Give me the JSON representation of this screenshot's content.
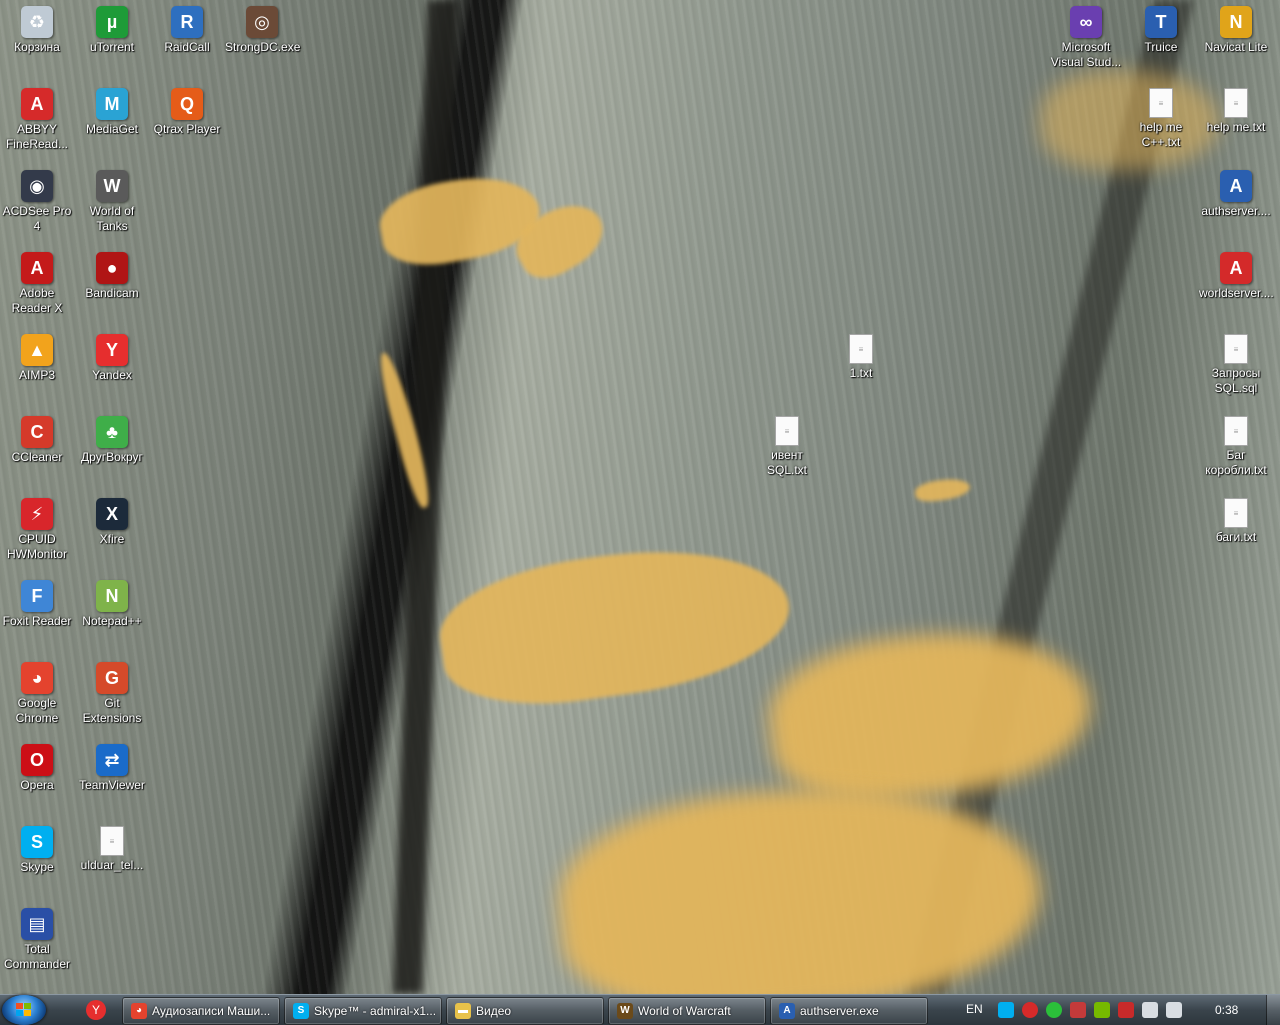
{
  "desktop_icons": [
    {
      "label": "Корзина",
      "icon": "recycle-bin-icon",
      "color": "#bfcad4"
    },
    {
      "label": "uTorrent",
      "icon": "utorrent-icon",
      "color": "#1e9b38"
    },
    {
      "label": "RaidCall",
      "icon": "raidcall-icon",
      "color": "#2e6fbf"
    },
    {
      "label": "StrongDC.exe",
      "icon": "strongdc-icon",
      "color": "#6b4a37"
    },
    {
      "label": "ABBYY FineRead...",
      "icon": "abbyy-icon",
      "color": "#d62a2a"
    },
    {
      "label": "MediaGet",
      "icon": "mediaget-icon",
      "color": "#2aa3d4"
    },
    {
      "label": "Qtrax Player",
      "icon": "qtrax-icon",
      "color": "#e55c19"
    },
    {
      "label": "ACDSee Pro 4",
      "icon": "acdsee-icon",
      "color": "#333a4a"
    },
    {
      "label": "World of Tanks",
      "icon": "world-of-tanks-icon",
      "color": "#5a5a5a"
    },
    {
      "label": "Adobe Reader X",
      "icon": "adobe-reader-icon",
      "color": "#c41a1a"
    },
    {
      "label": "Bandicam",
      "icon": "bandicam-icon",
      "color": "#b01515"
    },
    {
      "label": "AIMP3",
      "icon": "aimp-icon",
      "color": "#f2a31c"
    },
    {
      "label": "Yandex",
      "icon": "yandex-icon",
      "color": "#e62e2e"
    },
    {
      "label": "CCleaner",
      "icon": "ccleaner-icon",
      "color": "#d53a2a"
    },
    {
      "label": "ДругВокруг",
      "icon": "drugvokrug-icon",
      "color": "#3fae49"
    },
    {
      "label": "CPUID HWMonitor",
      "icon": "hwmonitor-icon",
      "color": "#d8262b"
    },
    {
      "label": "Xfire",
      "icon": "xfire-icon",
      "color": "#1c2a3a"
    },
    {
      "label": "Foxit Reader",
      "icon": "foxit-icon",
      "color": "#3f86d6"
    },
    {
      "label": "Notepad++",
      "icon": "notepadpp-icon",
      "color": "#7fb34a"
    },
    {
      "label": "Google Chrome",
      "icon": "chrome-icon",
      "color": "#e4432e"
    },
    {
      "label": "Git Extensions",
      "icon": "git-extensions-icon",
      "color": "#d54a2a"
    },
    {
      "label": "Opera",
      "icon": "opera-icon",
      "color": "#cc0f16"
    },
    {
      "label": "TeamViewer",
      "icon": "teamviewer-icon",
      "color": "#1a6bc9"
    },
    {
      "label": "Skype",
      "icon": "skype-icon",
      "color": "#00aff0"
    },
    {
      "label": "ulduar_tel...",
      "icon": "cpp-file-icon",
      "color": "#3a6bc9"
    },
    {
      "label": "Total Commander",
      "icon": "total-commander-icon",
      "color": "#2a4fa6"
    },
    {
      "label": "Microsoft Visual Stud...",
      "icon": "visual-studio-icon",
      "color": "#6a3fb0"
    },
    {
      "label": "Truice",
      "icon": "truice-icon",
      "color": "#2a5fb0"
    },
    {
      "label": "Navicat Lite",
      "icon": "navicat-icon",
      "color": "#e0a41a"
    },
    {
      "label": "help me C++.txt",
      "icon": "text-file-icon",
      "color": "#fbfbfb"
    },
    {
      "label": "help me.txt",
      "icon": "text-file-icon",
      "color": "#fbfbfb"
    },
    {
      "label": "authserver....",
      "icon": "authserver-icon",
      "color": "#2a5fb0"
    },
    {
      "label": "worldserver....",
      "icon": "worldserver-icon",
      "color": "#d42a2a"
    },
    {
      "label": "1.txt",
      "icon": "text-file-icon",
      "color": "#fbfbfb"
    },
    {
      "label": "Запросы SQL.sql",
      "icon": "sql-file-icon",
      "color": "#fbfbfb"
    },
    {
      "label": "ивент SQL.txt",
      "icon": "text-file-icon",
      "color": "#fbfbfb"
    },
    {
      "label": "Баг коробли.txt",
      "icon": "text-file-icon",
      "color": "#fbfbfb"
    },
    {
      "label": "баги.txt",
      "icon": "text-file-icon",
      "color": "#fbfbfb"
    }
  ],
  "taskbar": {
    "quick_launch": [
      {
        "icon": "yandex-icon",
        "color": "#e62e2e"
      }
    ],
    "buttons": [
      {
        "label": "Аудиозаписи Маши...",
        "icon": "chrome-icon",
        "color": "#e4432e"
      },
      {
        "label": "Skype™ - admiral-x1...",
        "icon": "skype-icon",
        "color": "#00aff0"
      },
      {
        "label": "Видео",
        "icon": "folder-icon",
        "color": "#e8c24a"
      },
      {
        "label": "World of Warcraft",
        "icon": "world-of-warcraft-icon",
        "color": "#6b4a1a"
      },
      {
        "label": "authserver.exe",
        "icon": "authserver-icon",
        "color": "#2a5fb0"
      }
    ],
    "language": "EN",
    "tray_icons": [
      {
        "icon": "skype-tray-icon",
        "color": "#00aff0"
      },
      {
        "icon": "red-status-icon",
        "color": "#d62a2a"
      },
      {
        "icon": "green-status-icon",
        "color": "#2bbf3a"
      },
      {
        "icon": "flag-tray-icon",
        "color": "#c43a3a"
      },
      {
        "icon": "nvidia-icon",
        "color": "#76b900"
      },
      {
        "icon": "security-tray-icon",
        "color": "#c82a2a"
      },
      {
        "icon": "network-icon",
        "color": "#d8dde2"
      },
      {
        "icon": "volume-icon",
        "color": "#d8dde2"
      }
    ],
    "clock": "0:38"
  }
}
